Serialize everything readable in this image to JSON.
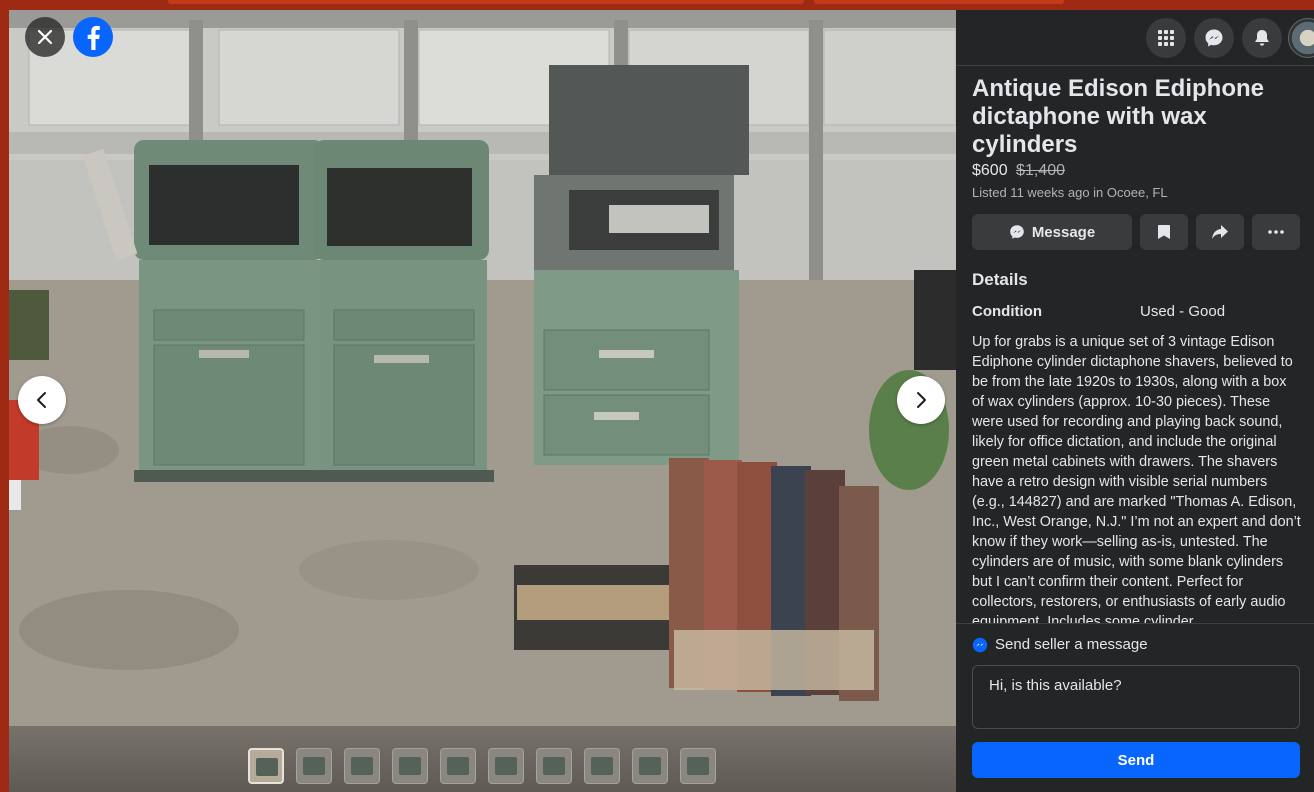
{
  "viewer": {
    "icons": {
      "close": "close-icon",
      "brand": "facebook-logo-icon",
      "prev": "chevron-left-icon",
      "next": "chevron-right-icon"
    },
    "thumbnail_count": 10,
    "active_thumbnail": 1
  },
  "topbar": {
    "icons": [
      "menu-grid-icon",
      "messenger-icon",
      "notifications-bell-icon",
      "profile-avatar"
    ]
  },
  "listing": {
    "title": "Antique Edison Ediphone dictaphone with wax cylinders",
    "price": "$600",
    "original_price": "$1,400",
    "listed": "Listed 11 weeks ago in Ocoee, FL",
    "actions": {
      "message_label": "Message",
      "save_icon": "bookmark-icon",
      "share_icon": "share-icon",
      "more_icon": "more-icon"
    },
    "details_heading": "Details",
    "condition_label": "Condition",
    "condition_value": "Used - Good",
    "description": "Up for grabs is a unique set of 3 vintage Edison Ediphone cylinder dictaphone shavers, believed to be from the late 1920s to 1930s, along with a box of wax cylinders (approx. 10-30 pieces). These were used for recording and playing back sound, likely for office dictation, and include the original green metal cabinets with drawers. The shavers have a retro design with visible serial numbers (e.g., 144827) and are marked \"Thomas A. Edison, Inc., West Orange, N.J.\" I’m not an expert and don’t know if they work—selling as-is, untested. The cylinders are of music, with some blank cylinders but I can’t confirm their content. Perfect for collectors, restorers, or enthusiasts of early audio equipment. Includes some cylinder"
  },
  "messaging": {
    "heading": "Send seller a message",
    "message_value": "Hi, is this available?",
    "send_label": "Send"
  },
  "colors": {
    "accent": "#0866ff",
    "panel_bg": "#242526",
    "button_bg": "#3a3b3c",
    "text_primary": "#e4e6eb",
    "text_secondary": "#b0b3b8"
  }
}
